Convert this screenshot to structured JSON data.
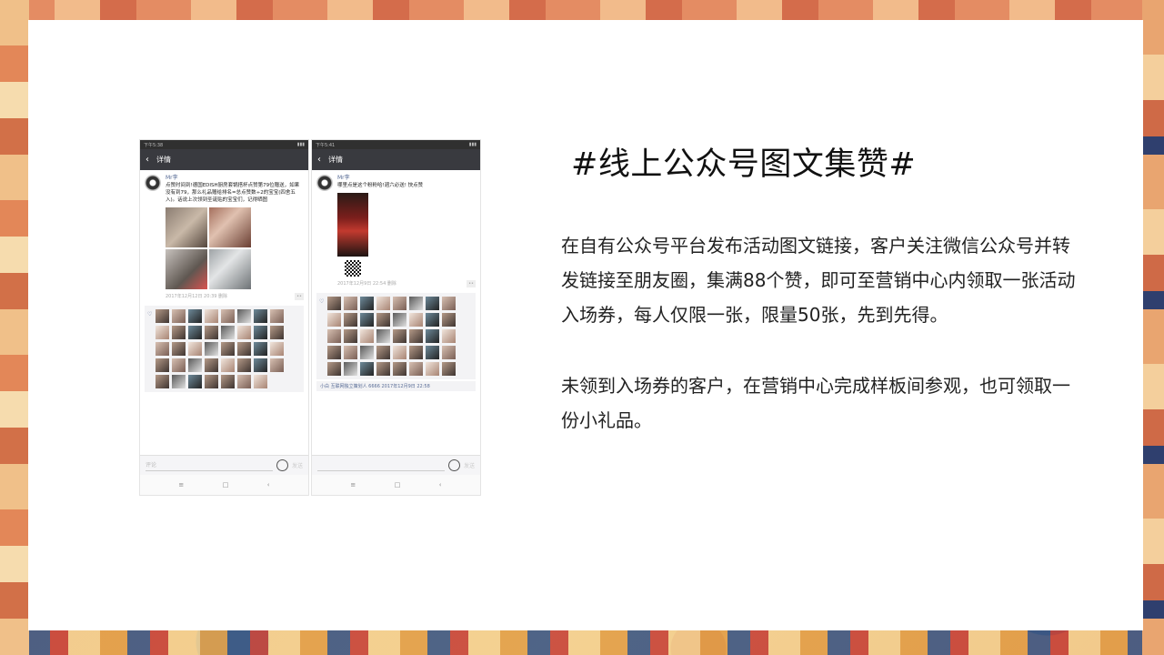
{
  "slide": {
    "title": "#线上公众号图文集赞#",
    "paragraph_1": "在自有公众号平台发布活动图文链接，客户关注微信公众号并转发链接至朋友圈，集满88个赞，即可至营销中心内领取一张活动入场券，每人仅限一张，限量50张，先到先得。",
    "paragraph_2": "未领到入场券的客户，在营销中心完成样板间参观，也可领取一份小礼品。"
  },
  "screenshots": [
    {
      "status_time": "下午5:38",
      "nav_title": "详情",
      "author": "Mr李",
      "post_text": "点赞时间到!德国EDISH厨房套锅搭杯点赞第79位赠送，如果没有到79，那么礼品赠给排名=总点赞数÷2的宝宝(四舍五入)。话说上次领到圣诞贴的宝宝们，记得晒图",
      "timestamp": "2017年12月12日 20:39",
      "delete_label": "删除",
      "input_placeholder": "评论",
      "send_label": "发送"
    },
    {
      "status_time": "下午5:41",
      "nav_title": "详情",
      "author": "Mr李",
      "post_text": "哪里点是这个粉粉哈!週六必送! 快点赞",
      "timestamp": "2017年12月9日 22:54",
      "delete_label": "删除",
      "comment": "小白 互联网独立策划人 6666",
      "comment_time": "2017年12月9日 22:58",
      "input_placeholder": "",
      "send_label": "发送"
    }
  ],
  "colors": {
    "title": "#111111",
    "body_text": "#222222",
    "slide_bg": "#ffffff",
    "wechat_link": "#576b95",
    "nav_bg": "#393a3f"
  }
}
